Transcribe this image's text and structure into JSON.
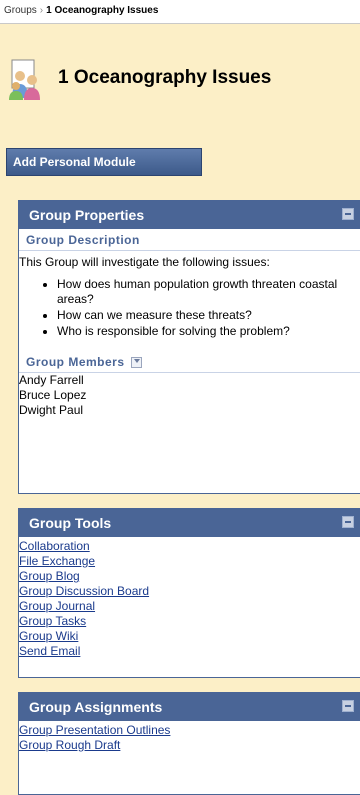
{
  "breadcrumb": {
    "parent": "Groups",
    "separator": "›",
    "current": "1 Oceanography Issues"
  },
  "header": {
    "title": "1 Oceanography Issues",
    "icon": "group-users-icon",
    "add_module_label": "Add Personal Module"
  },
  "properties": {
    "title": "Group Properties",
    "description_heading": "Group Description",
    "description_intro": "This Group will investigate the following issues:",
    "issues": [
      "How does human population growth threaten coastal areas?",
      "How can we measure these threats?",
      "Who is responsible for solving the problem?"
    ],
    "members_heading": "Group Members",
    "members": [
      "Andy Farrell",
      "Bruce Lopez",
      "Dwight Paul"
    ]
  },
  "tools": {
    "title": "Group Tools",
    "links": [
      "Collaboration",
      "File Exchange",
      "Group Blog",
      "Group Discussion Board",
      "Group Journal",
      "Group Tasks",
      "Group Wiki",
      "Send Email"
    ]
  },
  "assignments": {
    "title": "Group Assignments",
    "links": [
      "Group Presentation Outlines",
      "Group Rough Draft"
    ]
  },
  "colors": {
    "module_header": "#4a6596",
    "header_bg": "#fcefc7",
    "link": "#1a3a8c"
  }
}
